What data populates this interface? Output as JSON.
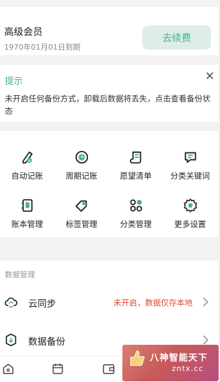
{
  "membership": {
    "title": "高级会员",
    "expiry": "1970年01月01日到期",
    "renew_label": "去续费"
  },
  "tip": {
    "title": "提示",
    "message": "未开启任何备份方式，卸载后数据将丢失，点击查看备份状态",
    "close_icon": "close-icon"
  },
  "features": [
    {
      "label": "自动记账",
      "icon": "pen-icon"
    },
    {
      "label": "周期记账",
      "icon": "clock-icon"
    },
    {
      "label": "愿望清单",
      "icon": "scroll-icon"
    },
    {
      "label": "分类关键词",
      "icon": "chat-bubble-icon"
    },
    {
      "label": "账本管理",
      "icon": "ledger-icon"
    },
    {
      "label": "标签管理",
      "icon": "tag-icon"
    },
    {
      "label": "分类管理",
      "icon": "grid-icon"
    },
    {
      "label": "更多设置",
      "icon": "gear-icon"
    }
  ],
  "data_management": {
    "section_title": "数据管理",
    "items": [
      {
        "label": "云同步",
        "status": "未开启，数据仅存本地",
        "icon": "cloud-sync-icon"
      },
      {
        "label": "数据备份",
        "status": "",
        "icon": "backup-icon"
      }
    ]
  },
  "tabbar": {
    "tabs": [
      {
        "icon": "home-icon"
      },
      {
        "icon": "calendar-icon"
      },
      {
        "icon": "wallet-icon"
      },
      {
        "icon": "chart-icon"
      },
      {
        "icon": "profile-icon"
      }
    ]
  },
  "watermark": {
    "line1": "八神智能天下",
    "line2": "zntx.cc"
  },
  "colors": {
    "accent": "#4fae8a",
    "renew_bg": "#dceee7",
    "warning": "#e04a3c",
    "background": "#f2f2f2"
  }
}
